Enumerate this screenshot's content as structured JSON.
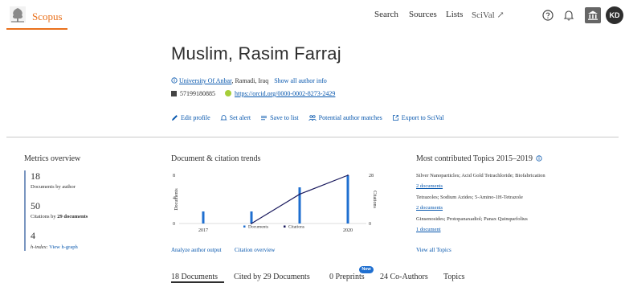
{
  "header": {
    "brand": "Scopus",
    "nav": [
      "Search",
      "Sources",
      "Lists",
      "SciVal ↗"
    ],
    "avatar_initials": "KD",
    "accent_color": "#e9711c"
  },
  "author": {
    "name": "Muslim, Rasim Farraj",
    "affiliation_link": "University Of Anbar",
    "affiliation_location": ", Ramadi, Iraq",
    "show_all_info": "Show all author info",
    "scopus_id": "57199180885",
    "orcid": "https://orcid.org/0000-0002-8273-2429"
  },
  "actions": {
    "edit_profile": "Edit profile",
    "set_alert": "Set alert",
    "save_to_list": "Save to list",
    "potential_matches": "Potential author matches",
    "export_scival": "Export to SciVal"
  },
  "metrics": {
    "title": "Metrics overview",
    "documents_value": "18",
    "documents_label": "Documents by author",
    "citations_value": "50",
    "citations_label_prefix": "Citations by ",
    "citations_label_count": "29 documents",
    "hindex_value": "4",
    "hindex_label": "h-index:",
    "view_hgraph": "View h-graph"
  },
  "trends": {
    "title": "Document & citation trends",
    "analyze_link": "Analyze author output",
    "citation_overview_link": "Citation overview"
  },
  "chart_data": {
    "type": "bar",
    "x": [
      2017,
      2018,
      2019,
      2020
    ],
    "x_tick_labels": [
      "2017",
      "2020"
    ],
    "y_left_label": "Documents",
    "y_right_label": "Citations",
    "y_left_ticks": [
      "8",
      "4",
      "0"
    ],
    "y_right_ticks": [
      "28",
      "0"
    ],
    "y_left_lim": [
      0,
      8
    ],
    "y_right_lim": [
      0,
      28
    ],
    "series": [
      {
        "name": "Documents",
        "kind": "bar",
        "axis": "left",
        "color": "#1f6fd0",
        "values": [
          2,
          2,
          6,
          8
        ]
      },
      {
        "name": "Citations",
        "kind": "line",
        "axis": "right",
        "color": "#1a1a5e",
        "values": [
          0,
          0,
          17,
          28
        ]
      }
    ],
    "legend": [
      "Documents",
      "Citations"
    ],
    "legend_placement": "bottom"
  },
  "topics": {
    "title": "Most contributed Topics 2015–2019",
    "items": [
      {
        "name": "Silver Nanoparticles; Acid Gold Tetrachloride; Biofabrication",
        "docs": "2 documents"
      },
      {
        "name": "Tetrazoles; Sodium Azides; 5-Amino-1H-Tetrazole",
        "docs": "2 documents"
      },
      {
        "name": "Ginsenosides; Protopanaxadiol; Panax Quinquefolius",
        "docs": "1 document"
      }
    ],
    "view_all": "View all Topics"
  },
  "tabs": {
    "items": [
      "18 Documents",
      "Cited by 29 Documents",
      "0 Preprints",
      "24 Co-Authors",
      "Topics"
    ],
    "new_badge": "New"
  }
}
